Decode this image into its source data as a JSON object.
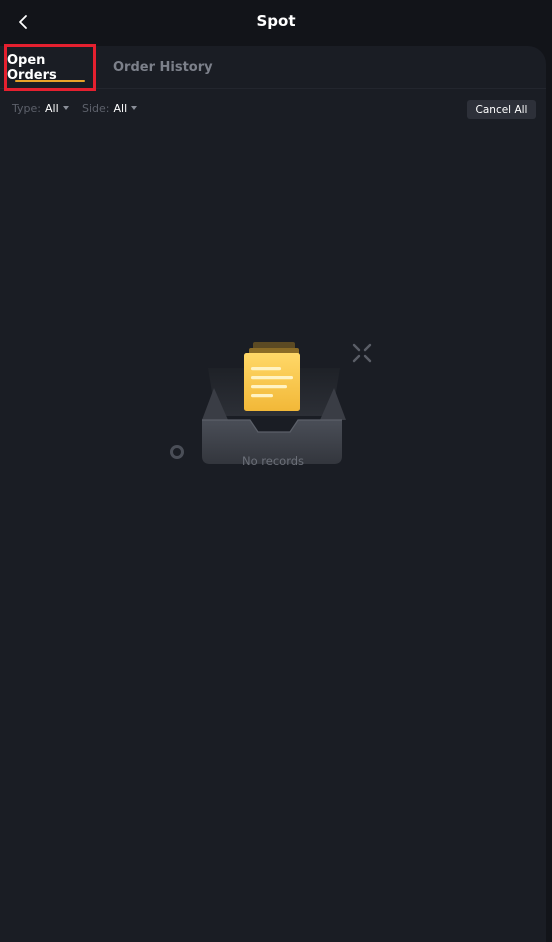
{
  "header": {
    "title": "Spot",
    "back_icon": "chevron-left-icon"
  },
  "tabs": [
    {
      "label": "Open Orders",
      "active": true
    },
    {
      "label": "Order History",
      "active": false
    }
  ],
  "filters": {
    "type": {
      "label": "Type:",
      "value": "All"
    },
    "side": {
      "label": "Side:",
      "value": "All"
    }
  },
  "actions": {
    "cancel_all_label": "Cancel All"
  },
  "empty_state": {
    "icon": "empty-inbox-document-icon",
    "text": "No records"
  },
  "colors": {
    "background": "#121419",
    "panel": "#1a1d24",
    "accent_underline": "#e8a32a",
    "highlight_box": "#e5202f",
    "document_yellow": "#f7c244"
  }
}
